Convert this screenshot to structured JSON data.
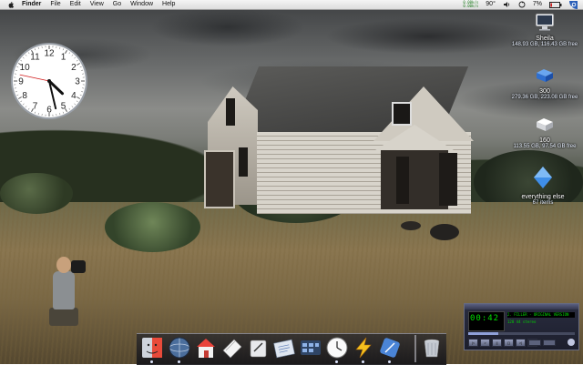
{
  "menubar": {
    "app_name": "Finder",
    "items": [
      "File",
      "Edit",
      "View",
      "Go",
      "Window",
      "Help"
    ],
    "temperature": "90°",
    "battery": "7%",
    "stats_line1": "0.00k/s",
    "stats_line2": "0.00k/s"
  },
  "desktop": {
    "drives": [
      {
        "name": "Sheila",
        "info": "148.93 GB, 116.43 GB free",
        "icon": "monitor-drive-icon"
      },
      {
        "name": "300",
        "info": "279.36 GB, 223.08 GB free",
        "icon": "blue-drive-icon"
      },
      {
        "name": "160",
        "info": "113.55 GB, 97.54 GB free",
        "icon": "white-drive-icon"
      },
      {
        "name": "everything else",
        "info": "67 items",
        "icon": "blue-diamond-folder-icon"
      }
    ]
  },
  "clock": {
    "numerals": [
      "12",
      "1",
      "2",
      "3",
      "4",
      "5",
      "6",
      "7",
      "8",
      "9",
      "10",
      "11"
    ],
    "hour": 4,
    "minute": 27,
    "second": 47
  },
  "dock": {
    "items": [
      "finder",
      "globe",
      "home",
      "mail",
      "pen-paper",
      "notepad",
      "dashboard",
      "clock",
      "lightning",
      "pencil-blue",
      "trash"
    ],
    "running": [
      "finder",
      "globe",
      "clock",
      "lightning",
      "pencil-blue"
    ]
  },
  "winamp": {
    "time": "00:42",
    "title": "2. FILLER - ORIGINAL VERSION",
    "kbps": "128",
    "khz": "44",
    "mode": "stereo",
    "progress": 0.28,
    "controls": [
      "|<",
      ">",
      "||",
      "[]",
      ">|",
      "^"
    ]
  },
  "colors": {
    "menubar": "#e6e6e6",
    "winamp_text": "#00e000",
    "dock_bg": "#202026"
  }
}
